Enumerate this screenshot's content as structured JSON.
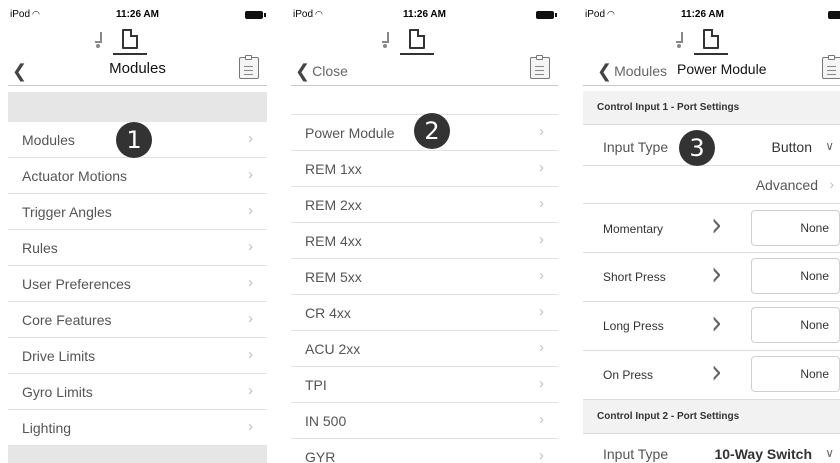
{
  "status": {
    "carrier": "iPod",
    "time": "11:26 AM"
  },
  "panel1": {
    "title": "Modules",
    "badge": "1",
    "items": [
      "Modules",
      "Actuator Motions",
      "Trigger Angles",
      "Rules",
      "User Preferences",
      "Core Features",
      "Drive Limits",
      "Gyro Limits",
      "Lighting"
    ]
  },
  "panel2": {
    "back": "Close",
    "badge": "2",
    "items": [
      "Power Module",
      "REM 1xx",
      "REM 2xx",
      "REM 4xx",
      "REM 5xx",
      "CR 4xx",
      "ACU 2xx",
      "TPI",
      "IN 500",
      "GYR"
    ]
  },
  "panel3": {
    "back": "Modules",
    "title": "Power Module",
    "badge": "3",
    "section1": "Control Input 1 - Port Settings",
    "input_type_label": "Input Type",
    "input_type_value": "Button",
    "advanced": "Advanced",
    "press_rows": [
      {
        "label": "Momentary",
        "value": "None"
      },
      {
        "label": "Short Press",
        "value": "None"
      },
      {
        "label": "Long Press",
        "value": "None"
      },
      {
        "label": "On Press",
        "value": "None"
      }
    ],
    "section2": "Control Input 2 - Port Settings",
    "input_type2_label": "Input Type",
    "input_type2_value": "10-Way Switch"
  },
  "icons": {
    "back": "chevron-left-icon",
    "forward": "chevron-right-icon",
    "dropdown": "chevron-down-icon",
    "clipboard": "clipboard-icon",
    "chair": "wheelchair-icon",
    "document": "document-icon"
  }
}
